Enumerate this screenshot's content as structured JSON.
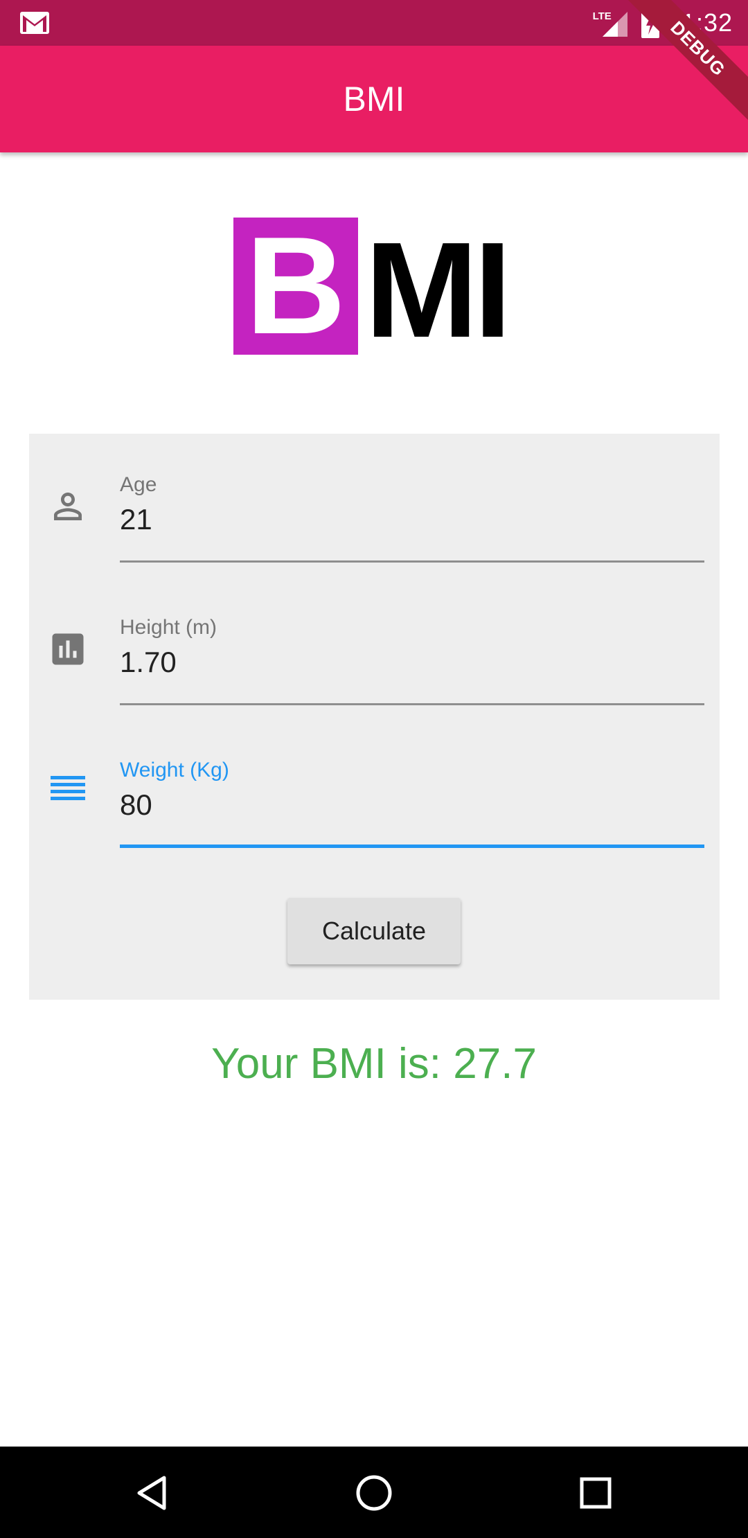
{
  "status_bar": {
    "time": "11:32",
    "network": "LTE",
    "left_icon": "gmail-icon",
    "signal_icon": "signal-icon",
    "battery_icon": "battery-charging-icon"
  },
  "debug_banner": "DEBUG",
  "app_bar": {
    "title": "BMI"
  },
  "logo": {
    "letter_b": "B",
    "letters_mi": "MI"
  },
  "form": {
    "fields": [
      {
        "label": "Age",
        "value": "21",
        "icon": "person-icon"
      },
      {
        "label": "Height (m)",
        "value": "1.70",
        "icon": "insert-chart-icon"
      },
      {
        "label": "Weight (Kg)",
        "value": "80",
        "icon": "weight-lines-icon"
      }
    ],
    "button_label": "Calculate"
  },
  "result": "Your BMI is: 27.7",
  "colors": {
    "status_bar": "#ad1750",
    "app_bar": "#e91e63",
    "accent": "#2196f3",
    "result": "#4caf50",
    "logo_magenta": "#c423c0"
  },
  "nav_bar": {
    "back_icon": "back-triangle-icon",
    "home_icon": "home-circle-icon",
    "recents_icon": "recents-square-icon"
  }
}
